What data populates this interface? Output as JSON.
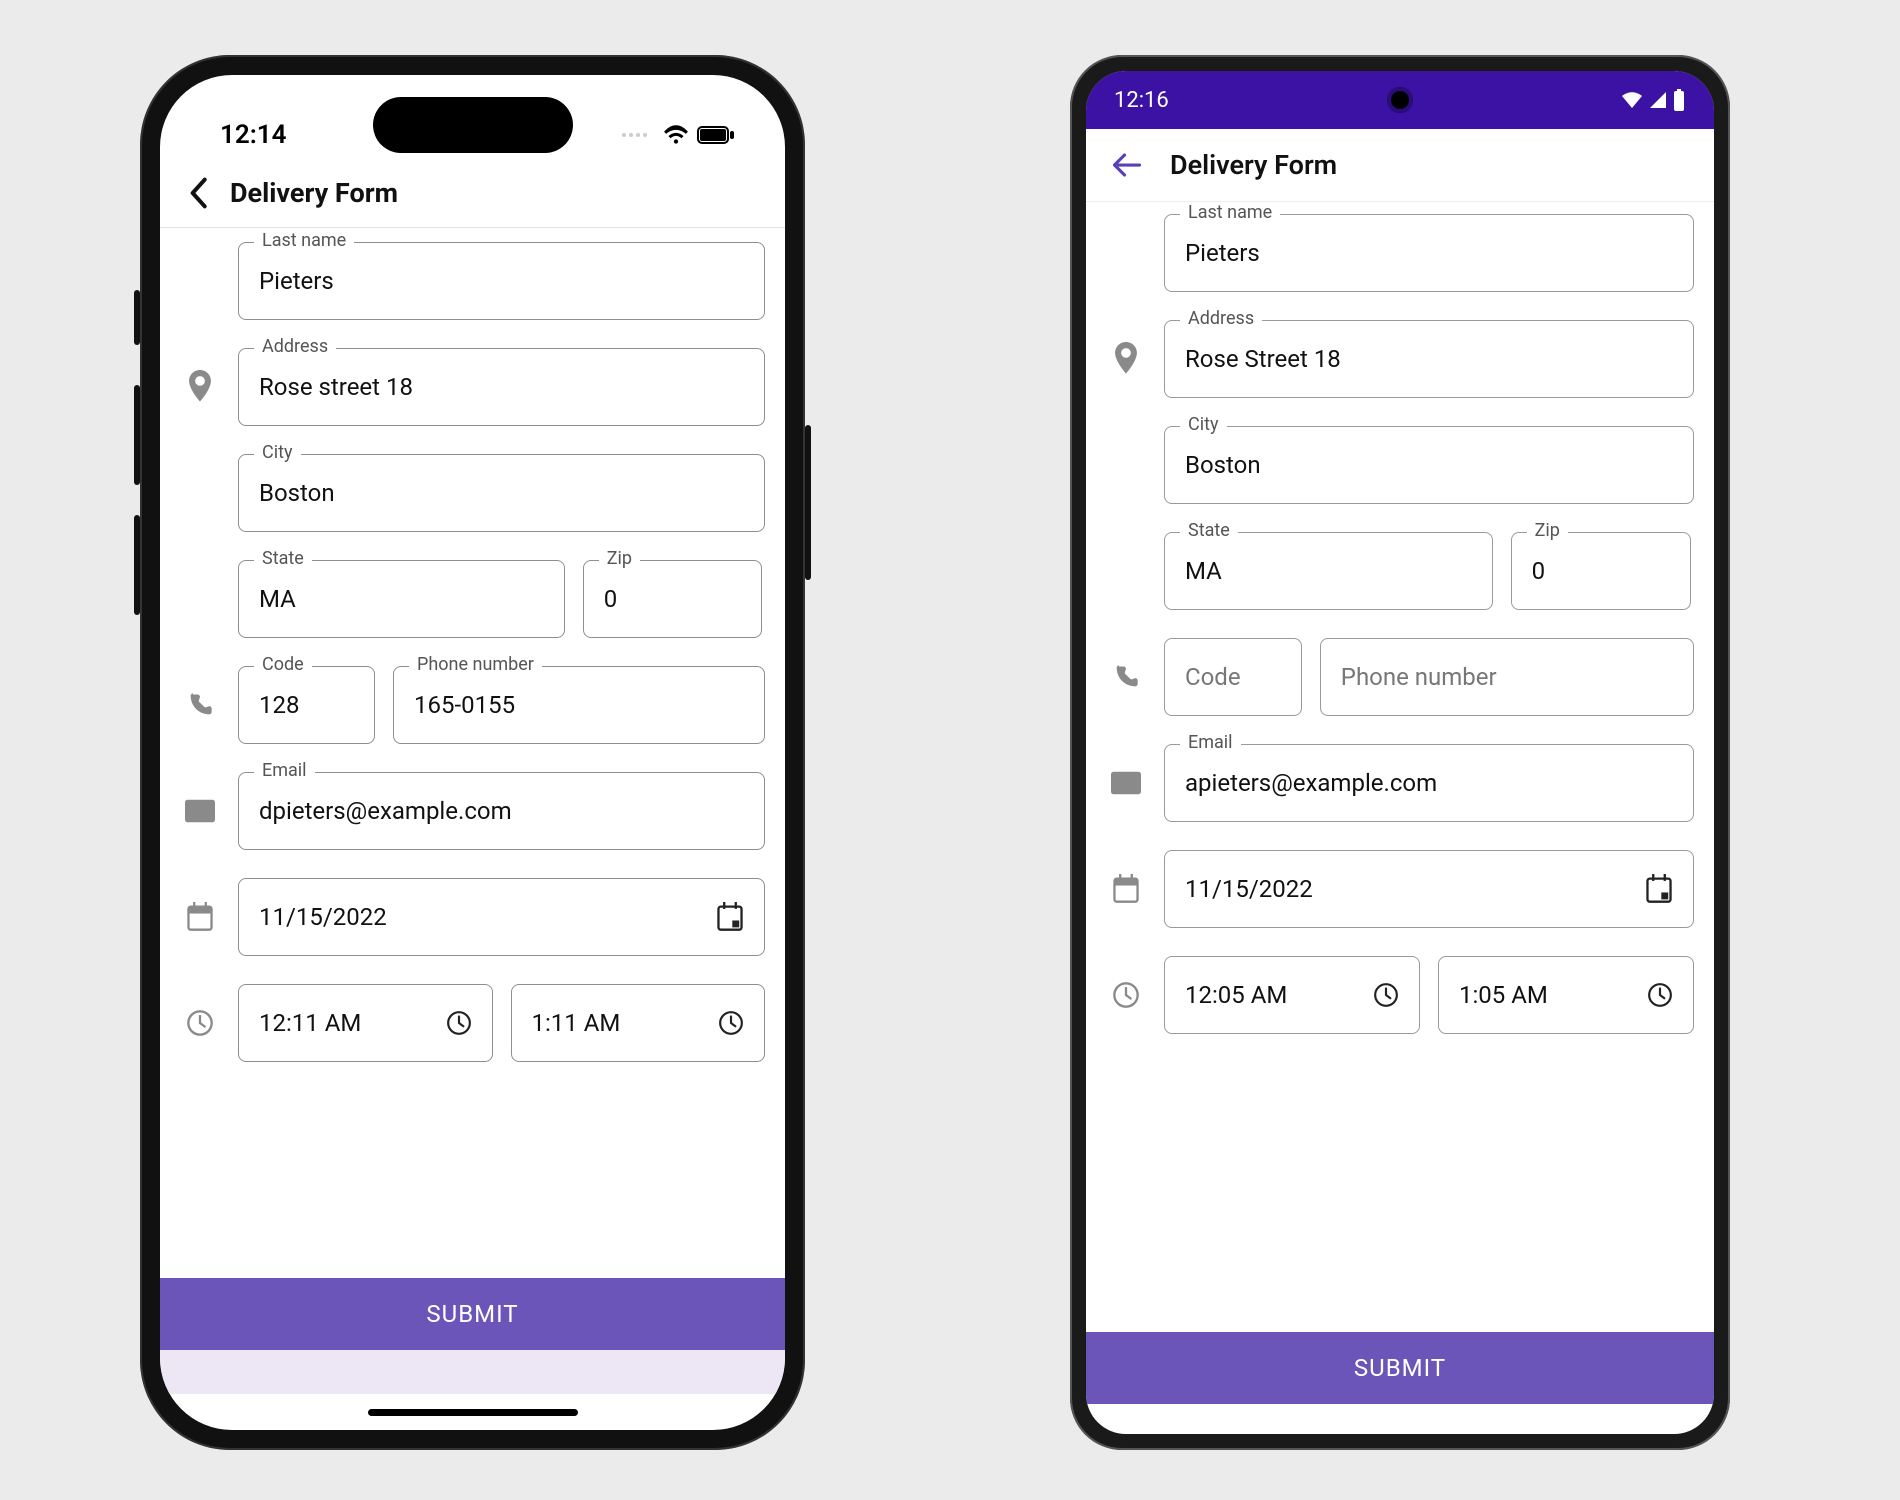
{
  "ios": {
    "status_time": "12:14",
    "header_title": "Delivery Form",
    "fields": {
      "lastname_label": "Last name",
      "lastname_value": "Pieters",
      "address_label": "Address",
      "address_value": "Rose street 18",
      "city_label": "City",
      "city_value": "Boston",
      "state_label": "State",
      "state_value": "MA",
      "zip_label": "Zip",
      "zip_value": "0",
      "code_label": "Code",
      "code_value": "128",
      "phone_label": "Phone number",
      "phone_value": "165-0155",
      "email_label": "Email",
      "email_value": "dpieters@example.com",
      "date_value": "11/15/2022",
      "time1_value": "12:11 AM",
      "time2_value": "1:11 AM"
    },
    "submit_label": "SUBMIT"
  },
  "android": {
    "status_time": "12:16",
    "header_title": "Delivery Form",
    "fields": {
      "lastname_label": "Last name",
      "lastname_value": "Pieters",
      "address_label": "Address",
      "address_value": "Rose Street 18",
      "city_label": "City",
      "city_value": "Boston",
      "state_label": "State",
      "state_value": "MA",
      "zip_label": "Zip",
      "zip_value": "0",
      "code_placeholder": "Code",
      "phone_placeholder": "Phone number",
      "email_label": "Email",
      "email_value": "apieters@example.com",
      "date_value": "11/15/2022",
      "time1_value": "12:05 AM",
      "time2_value": "1:05 AM"
    },
    "submit_label": "SUBMIT"
  },
  "colors": {
    "accent": "#6b55b8",
    "android_status": "#3b12a3"
  }
}
